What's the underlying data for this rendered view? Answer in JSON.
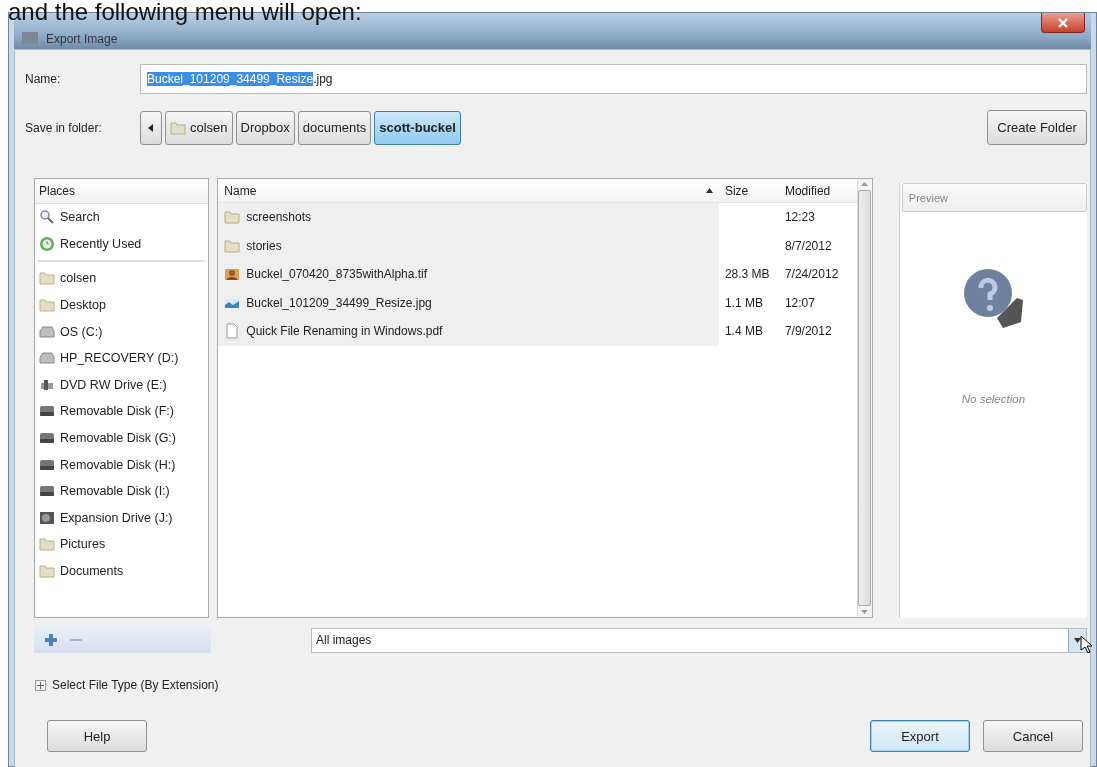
{
  "caption": "and the following menu will open:",
  "window": {
    "title": "Export Image"
  },
  "name_field": {
    "label": "Name:",
    "selected_text": "Buckel_101209_34499_Resize",
    "rest_text": ".jpg"
  },
  "folder_path": {
    "label": "Save in folder:",
    "segments": [
      {
        "label": "colsen",
        "kind": "home",
        "selected": false
      },
      {
        "label": "Dropbox",
        "kind": "plain",
        "selected": false
      },
      {
        "label": "documents",
        "kind": "plain",
        "selected": false
      },
      {
        "label": "scott-buckel",
        "kind": "plain",
        "selected": true
      }
    ]
  },
  "create_folder": {
    "label": "Create Folder"
  },
  "places": {
    "title": "Places",
    "groups": [
      [
        {
          "label": "Search",
          "kind": "search"
        },
        {
          "label": "Recently Used",
          "kind": "recent"
        }
      ],
      [
        {
          "label": "colsen",
          "kind": "folder"
        },
        {
          "label": "Desktop",
          "kind": "folder"
        },
        {
          "label": "OS (C:)",
          "kind": "drive"
        },
        {
          "label": "HP_RECOVERY (D:)",
          "kind": "drive"
        },
        {
          "label": "DVD RW Drive (E:)",
          "kind": "optical"
        },
        {
          "label": "Removable Disk (F:)",
          "kind": "removable"
        },
        {
          "label": "Removable Disk (G:)",
          "kind": "removable"
        },
        {
          "label": "Removable Disk (H:)",
          "kind": "removable"
        },
        {
          "label": "Removable Disk (I:)",
          "kind": "removable"
        },
        {
          "label": "Expansion Drive (J:)",
          "kind": "expansion"
        },
        {
          "label": "Pictures",
          "kind": "folder"
        },
        {
          "label": "Documents",
          "kind": "folder"
        }
      ]
    ]
  },
  "file_list": {
    "columns": [
      {
        "label": "Name",
        "sorted": true
      },
      {
        "label": "Size",
        "sorted": false
      },
      {
        "label": "Modified",
        "sorted": false
      }
    ],
    "rows": [
      {
        "name": "screenshots",
        "kind": "folder",
        "size": "",
        "modified": "12:23"
      },
      {
        "name": "stories",
        "kind": "folder",
        "size": "",
        "modified": "8/7/2012"
      },
      {
        "name": "Buckel_070420_8735withAlpha.tif",
        "kind": "photo",
        "size": "28.3 MB",
        "modified": "7/24/2012"
      },
      {
        "name": "Buckel_101209_34499_Resize.jpg",
        "kind": "image",
        "size": "1.1 MB",
        "modified": "12:07"
      },
      {
        "name": "Quick File Renaming in Windows.pdf",
        "kind": "document",
        "size": "1.4 MB",
        "modified": "7/9/2012"
      }
    ]
  },
  "preview": {
    "title": "Preview",
    "message": "No selection"
  },
  "filter": {
    "value": "All images"
  },
  "expander": {
    "label": "Select File Type (By Extension)",
    "expanded": false
  },
  "buttons": [
    {
      "label": "Help",
      "kind": "help",
      "default": false
    },
    {
      "label": "Export",
      "kind": "export",
      "default": true
    },
    {
      "label": "Cancel",
      "kind": "cancel",
      "default": false
    }
  ]
}
